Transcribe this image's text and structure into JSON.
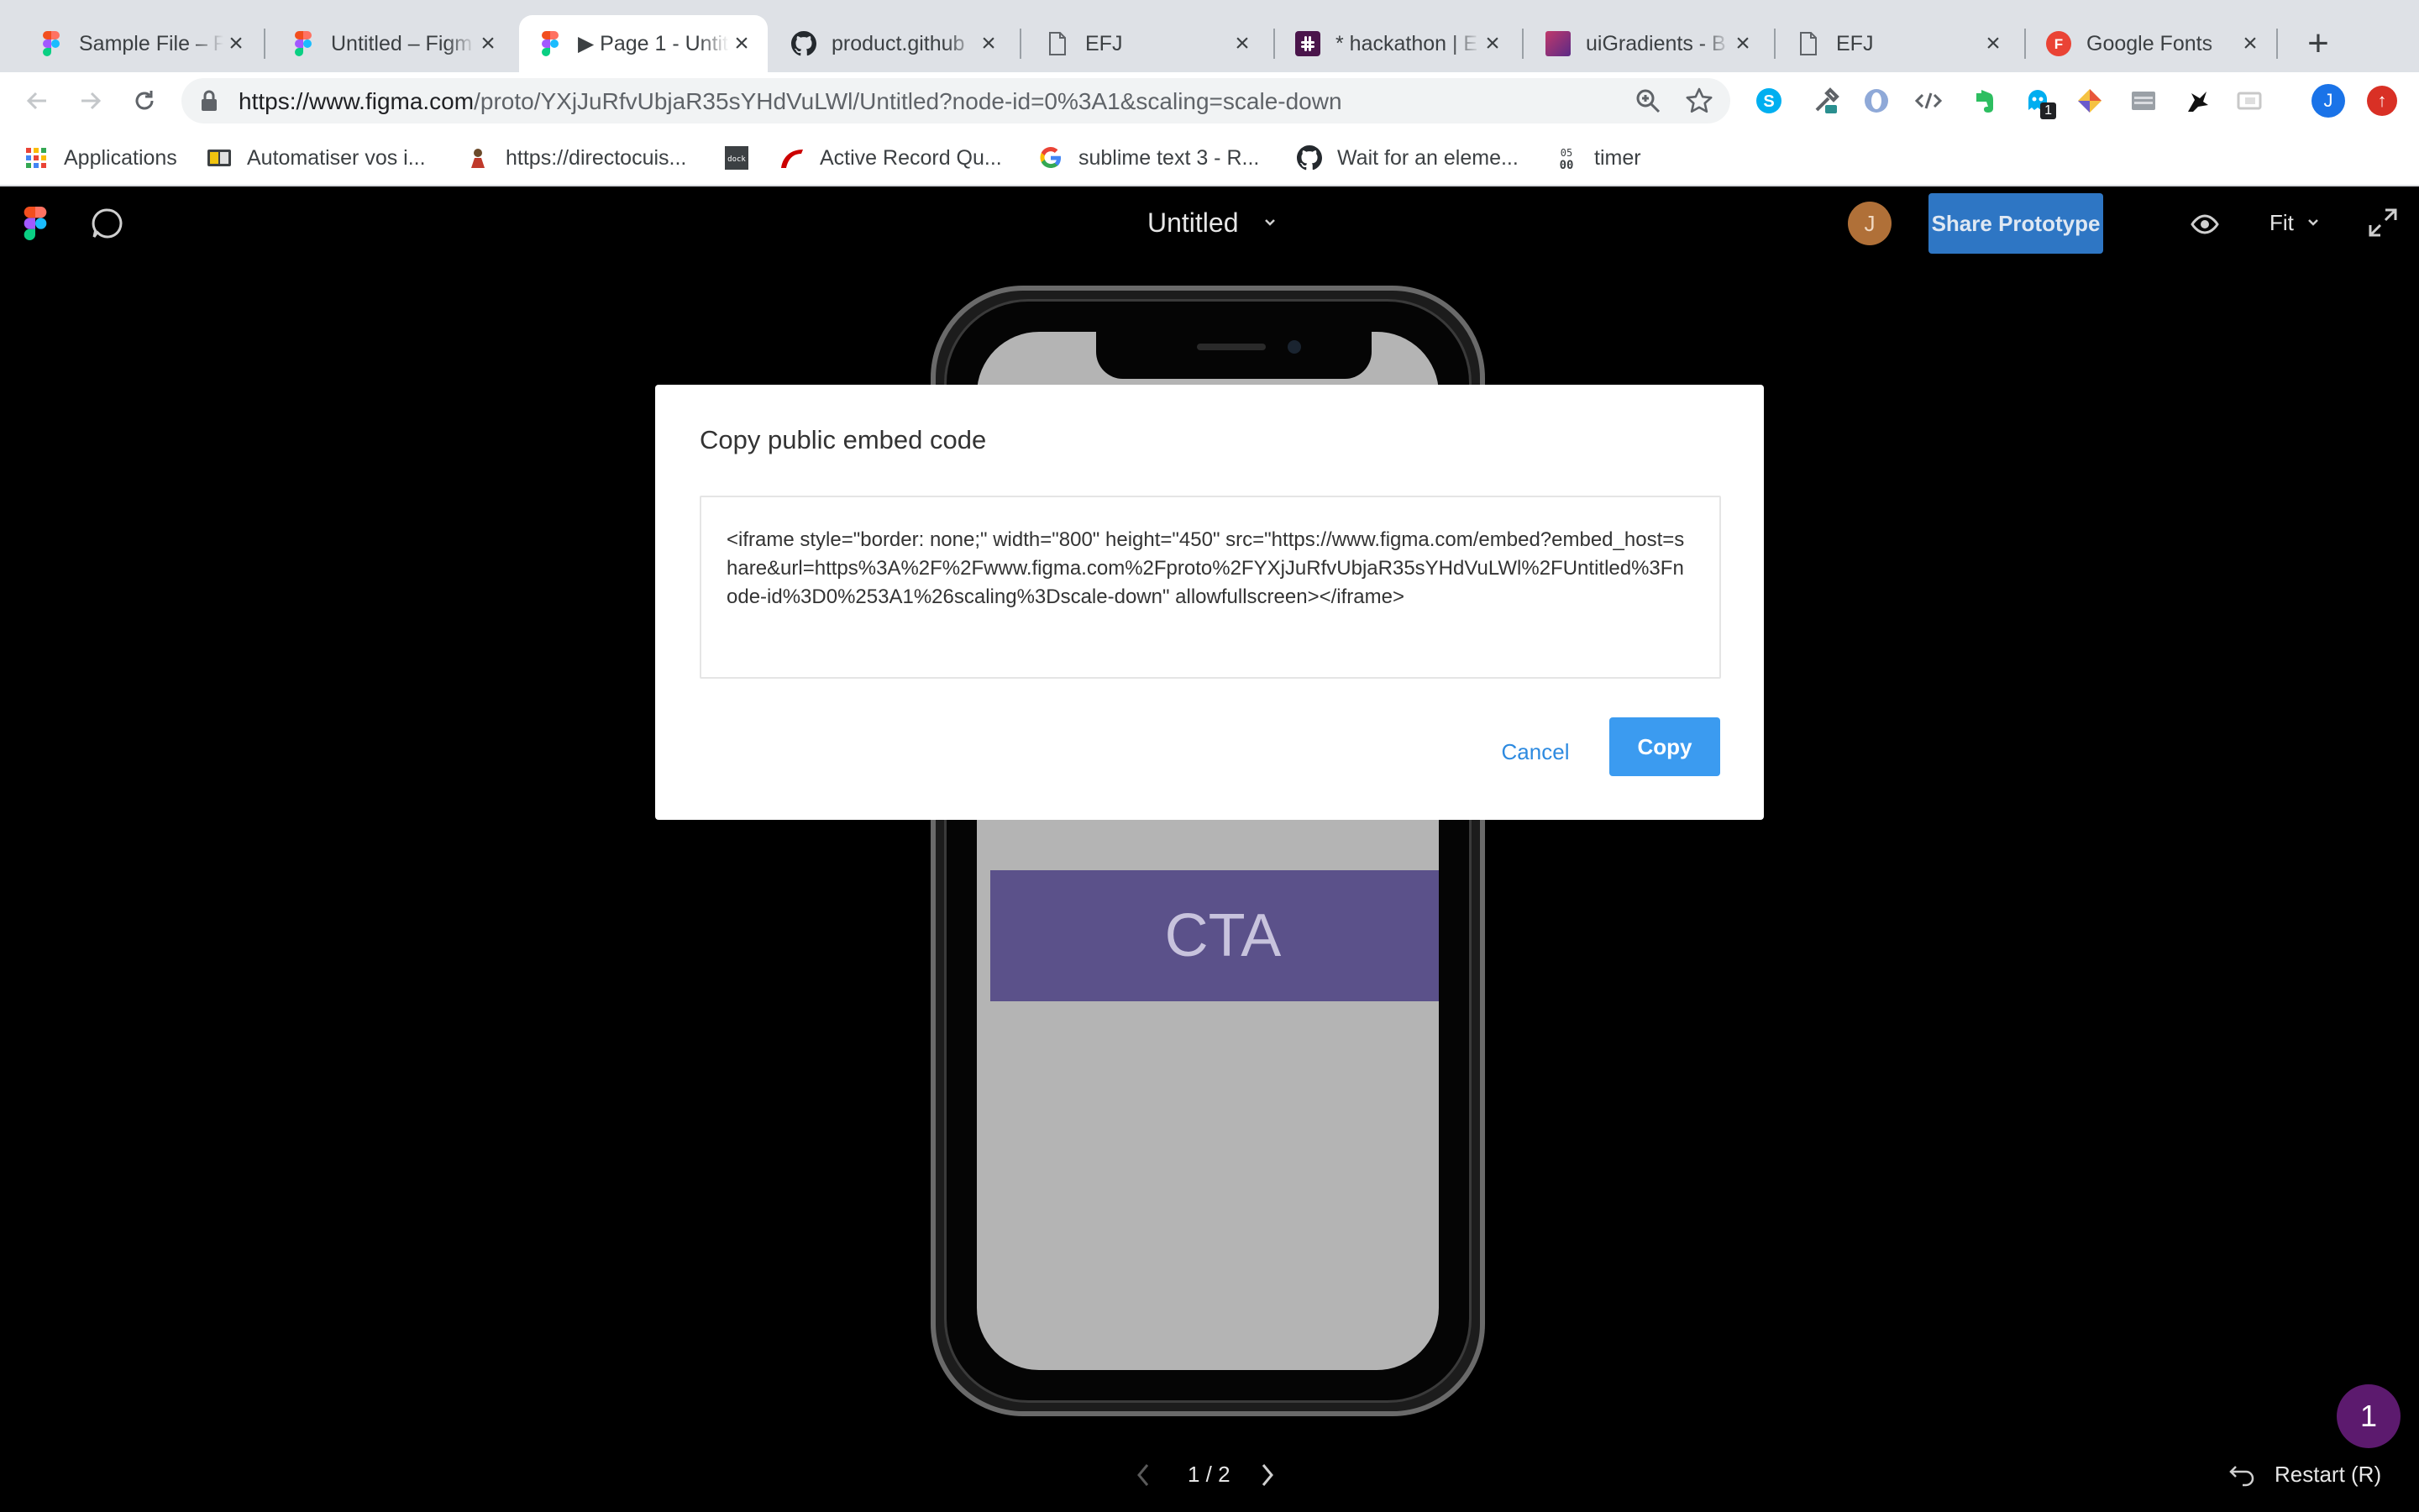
{
  "browser": {
    "tabs": [
      {
        "title": "Sample File – F",
        "icon": "figma-icon"
      },
      {
        "title": "Untitled – Figm",
        "icon": "figma-icon"
      },
      {
        "title": "▶ Page 1 - Untitl",
        "icon": "figma-icon",
        "active": true
      },
      {
        "title": "product.github",
        "icon": "github-icon"
      },
      {
        "title": "EFJ",
        "icon": "document-icon"
      },
      {
        "title": "* hackathon | E",
        "icon": "slack-icon"
      },
      {
        "title": "uiGradients - B",
        "icon": "gradient-icon"
      },
      {
        "title": "EFJ",
        "icon": "document-icon"
      },
      {
        "title": "Google Fonts",
        "icon": "google-fonts-icon"
      }
    ],
    "new_tab": "+",
    "url_host": "https://www.figma.com",
    "url_path": "/proto/YXjJuRfvUbjaR35sYHdVuLWl/Untitled?node-id=0%3A1&scaling=scale-down",
    "extensions_badge": "1",
    "profile_initial": "J",
    "bookmarks": [
      {
        "label": "Applications",
        "icon": "apps-grid-icon"
      },
      {
        "label": "Automatiser vos i...",
        "icon": "book-icon"
      },
      {
        "label": "https://directocuis...",
        "icon": "cook-icon"
      },
      {
        "label": "",
        "icon": "devdocs-icon"
      },
      {
        "label": "Active Record Qu...",
        "icon": "rails-icon"
      },
      {
        "label": "sublime text 3 - R...",
        "icon": "google-icon"
      },
      {
        "label": "Wait for an eleme...",
        "icon": "github-icon"
      },
      {
        "label": "timer",
        "icon": "timer-icon"
      }
    ]
  },
  "figma": {
    "file_title": "Untitled",
    "avatar_initial": "J",
    "share_label": "Share Prototype",
    "fit_label": "Fit",
    "cta_label": "CTA",
    "pager": "1 / 2",
    "restart_label": "Restart (R)",
    "notification_count": "1",
    "colors": {
      "share": "#2e76c4",
      "cta": "#5b518a",
      "copy": "#3b9bf0"
    }
  },
  "modal": {
    "title": "Copy public embed code",
    "embed_code": "<iframe style=\"border: none;\" width=\"800\" height=\"450\" src=\"https://www.figma.com/embed?embed_host=share&url=https%3A%2F%2Fwww.figma.com%2Fproto%2FYXjJuRfvUbjaR35sYHdVuLWl%2FUntitled%3Fnode-id%3D0%253A1%26scaling%3Dscale-down\" allowfullscreen></iframe>",
    "cancel_label": "Cancel",
    "copy_label": "Copy"
  }
}
